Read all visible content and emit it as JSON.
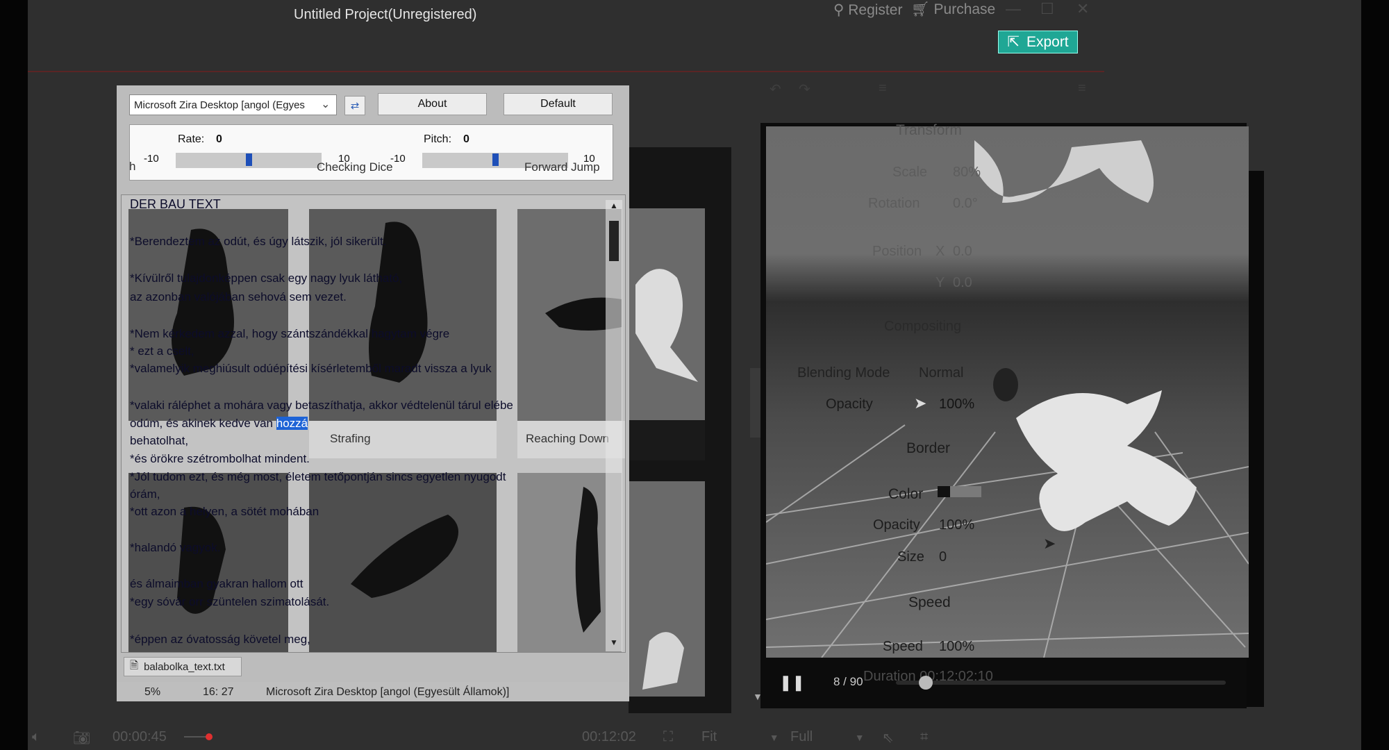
{
  "app": {
    "title": "Untitled Project(Unregistered)",
    "register_label": "Register",
    "purchase_label": "Purchase",
    "export_label": "Export"
  },
  "transform_panel": {
    "transform_heading": "Transform",
    "scale_label": "Scale",
    "scale_value": "80%",
    "rotation_label": "Rotation",
    "rotation_value": "0.0°",
    "position_label": "Position",
    "position_x_label": "X",
    "position_x_value": "0.0",
    "position_y_label": "Y",
    "position_y_value": "0.0",
    "compositing_heading": "Compositing",
    "blending_mode_label": "Blending Mode",
    "blending_mode_value": "Normal",
    "opacity_label": "Opacity",
    "opacity_value": "100%",
    "border_heading": "Border",
    "border_color_label": "Color",
    "border_opacity_label": "Opacity",
    "border_opacity_value": "100%",
    "border_size_label": "Size",
    "border_size_value": "0",
    "speed_heading": "Speed",
    "speed_label": "Speed",
    "speed_value": "100%"
  },
  "player": {
    "frame_counter": "8 / 90",
    "duration_label": "Duration",
    "duration_value": "00:12:02:10"
  },
  "bottom_bar": {
    "current_time": "00:00:45",
    "total_time": "00:12:02",
    "fit_label": "Fit",
    "quality_label": "Full"
  },
  "balabolka": {
    "voice_value": "Microsoft Zira Desktop [angol (Egyes",
    "about_label": "About",
    "default_label": "Default",
    "rate_label": "Rate:",
    "rate_value": "0",
    "pitch_label": "Pitch:",
    "pitch_value": "0",
    "rate_min": "-10",
    "rate_max": "10",
    "pitch_min": "-10",
    "pitch_max": "10",
    "text_heading": "DER BAU TEXT",
    "lines": [
      "*Berendeztem az odút, és úgy látszik, jól sikerült.",
      "*Kívülről tulajdonképpen csak egy nagy lyuk látható,",
      "az azonban valójában sehová sem vezet.",
      "*Nem kérkedem azzal, hogy szántszándékkal hagytam végre",
      "* ezt a cselt,",
      "*valamelyik meghiúsult odúépítési kísérletemből maradt vissza a lyuk",
      "*valaki ráléphet a mohára vagy betaszíthatja, akkor védtelenül tárul elébe",
      "odúm, és akinek kedve van",
      "behatolhat,",
      "*és örökre szétrombolhat mindent.",
      "*Jól tudom ezt, és még most, életem tetőpontján sincs egyetlen nyugodt",
      "órám,",
      "*ott azon a helyen, a sötét mohában",
      "*halandó vagyok.",
      "és álmaimban gyakran hallom ott",
      "*egy sóvár orr szüntelen szimatolását.",
      "*éppen az óvatosság követel meg,"
    ],
    "highlighted_word": "hozzá",
    "file_tab": "balabolka_text.txt",
    "status_percent": "5%",
    "status_position": "16: 27",
    "status_voice": "Microsoft Zira Desktop [angol (Egyesült Államok)]"
  },
  "behind_labels": {
    "checking_dice": "Checking Dice",
    "forward_jump": "Forward Jump",
    "strafing": "Strafing",
    "reaching_down": "Reaching Down",
    "edge_fragment": "h"
  },
  "colors": {
    "export_accent": "#1fa795",
    "selection_blue": "#1d63d6",
    "record_dot": "#e03030"
  }
}
